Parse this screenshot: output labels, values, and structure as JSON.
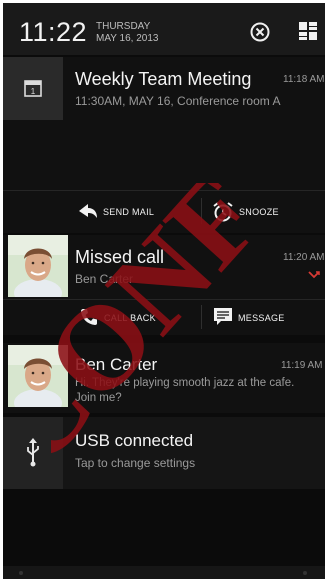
{
  "status": {
    "time": "11:22",
    "weekday": "THURSDAY",
    "date": "MAY 16, 2013",
    "clear_icon": "clear-all-icon",
    "settings_icon": "quick-settings-icon"
  },
  "notifications": [
    {
      "title": "Weekly Team Meeting",
      "subtitle": "11:30AM, MAY 16, Conference room A",
      "time": "11:18 AM",
      "icon": "calendar-icon",
      "actions": [
        {
          "label": "SEND MAIL",
          "icon": "send-mail-icon"
        },
        {
          "label": "SNOOZE",
          "icon": "snooze-alarm-icon"
        }
      ]
    },
    {
      "title": "Missed call",
      "subtitle": "Ben Carter",
      "time": "11:20 AM",
      "icon": "missed-call-icon",
      "actions": [
        {
          "label": "CALL BACK",
          "icon": "phone-icon"
        },
        {
          "label": "MESSAGE",
          "icon": "message-icon"
        }
      ]
    },
    {
      "title": "Ben Carter",
      "subtitle_line1": "Hi. They're playing smooth jazz at the cafe.",
      "subtitle_line2": "Join me?",
      "time": "11:19 AM"
    },
    {
      "title": "USB connected",
      "subtitle": "Tap to change settings",
      "icon": "usb-icon"
    }
  ],
  "watermark": {
    "text": "CONF",
    "color": "#8b0f14"
  }
}
